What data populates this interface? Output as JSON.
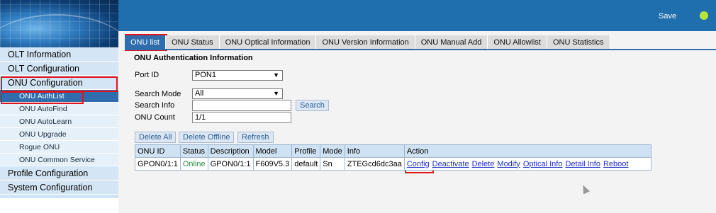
{
  "header": {
    "save_label": "Save",
    "status_color": "#b7e33a"
  },
  "sidebar": {
    "olt_information": "OLT Information",
    "olt_configuration": "OLT Configuration",
    "onu_configuration": "ONU Configuration",
    "sub_items": [
      "ONU AuthList",
      "ONU AutoFind",
      "ONU AutoLearn",
      "ONU Upgrade",
      "Rogue ONU",
      "ONU Common Service"
    ],
    "profile_configuration": "Profile Configuration",
    "system_configuration": "System Configuration"
  },
  "tabs": [
    "ONU list",
    "ONU Status",
    "ONU Optical Information",
    "ONU Version Information",
    "ONU Manual Add",
    "ONU Allowlist",
    "ONU Statistics"
  ],
  "form": {
    "section_title": "ONU Authentication Information",
    "port_id_label": "Port ID",
    "port_id_value": "PON1",
    "search_mode_label": "Search Mode",
    "search_mode_value": "All",
    "search_info_label": "Search Info",
    "search_info_value": "",
    "search_button": "Search",
    "onu_count_label": "ONU Count",
    "onu_count_value": "1/1"
  },
  "buttons": {
    "delete_all": "Delete All",
    "delete_offline": "Delete Offline",
    "refresh": "Refresh"
  },
  "table": {
    "headers": [
      "ONU ID",
      "Status",
      "Description",
      "Model",
      "Profile",
      "Mode",
      "Info",
      "Action"
    ],
    "row": {
      "onu_id": "GPON0/1:1",
      "status": "Online",
      "description": "GPON0/1:1",
      "model": "F609V5.3",
      "profile": "default",
      "mode": "Sn",
      "info": "ZTEGcd6dc3aa",
      "actions": [
        "Config",
        "Deactivate",
        "Delete",
        "Modify",
        "Optical Info",
        "Detail Info",
        "Reboot"
      ]
    }
  },
  "colors": {
    "accent": "#2f6dac",
    "highlight_border": "#e0141b",
    "online": "#2b8a3e",
    "link": "#1c2fc4"
  }
}
